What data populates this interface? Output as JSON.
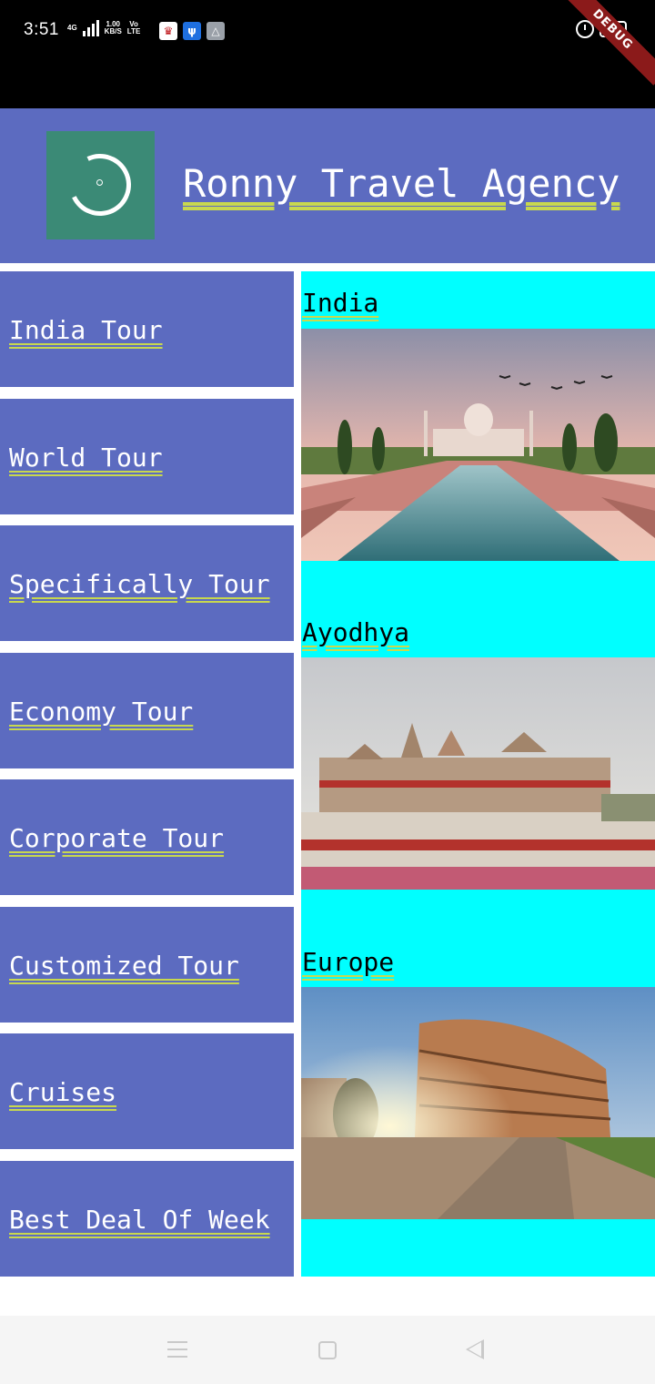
{
  "status_bar": {
    "time": "3:51",
    "network": "4G",
    "speed_value": "1.00",
    "speed_unit": "KB/S",
    "volte_top": "Vo",
    "volte_bottom": "LTE",
    "battery": "80",
    "debug": "DEBUG"
  },
  "header": {
    "title": "Ronny Travel Agency",
    "logo_icon": "travel-agency-logo"
  },
  "menu": {
    "items": [
      {
        "label": "India Tour"
      },
      {
        "label": "World Tour"
      },
      {
        "label": "Specifically Tour"
      },
      {
        "label": "Economy Tour"
      },
      {
        "label": "Corporate Tour"
      },
      {
        "label": "Customized Tour"
      },
      {
        "label": "Cruises"
      },
      {
        "label": "Best Deal Of Week"
      }
    ]
  },
  "destinations": [
    {
      "label": "India",
      "image": "taj-mahal-photo"
    },
    {
      "label": "Ayodhya",
      "image": "ram-temple-photo"
    },
    {
      "label": "Europe",
      "image": "colosseum-photo"
    }
  ],
  "colors": {
    "primary": "#5c6bc0",
    "accent_panel": "#00ffff",
    "logo_bg": "#3b8a76",
    "underline": "#c8d84e"
  },
  "nav": {
    "recents_icon": "recents-icon",
    "home_icon": "home-icon",
    "back_icon": "back-icon"
  }
}
